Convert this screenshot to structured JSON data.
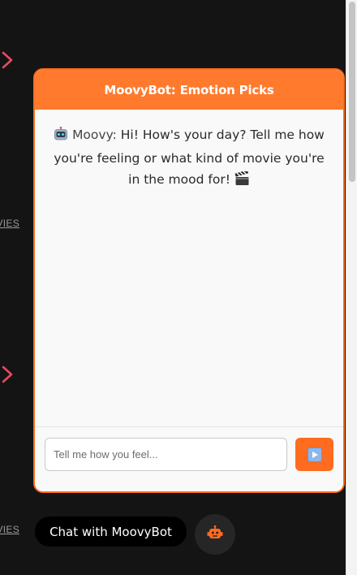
{
  "background": {
    "link_text": "VIES",
    "accent_color": "#e84a5f"
  },
  "chat": {
    "title": "MoovyBot: Emotion Picks",
    "message": {
      "icon": "robot-face-icon",
      "sender": "Moovy:",
      "text": "Hi! How's your day? Tell me how you're feeling or what kind of movie you're in the mood for!",
      "trailing_icon": "clapper-board-icon"
    },
    "input": {
      "placeholder": "Tell me how you feel...",
      "value": ""
    },
    "send_icon": "play-button-icon",
    "accent_color": "#ff6b1f"
  },
  "launcher": {
    "label": "Chat with MoovyBot",
    "icon": "robot-icon"
  }
}
